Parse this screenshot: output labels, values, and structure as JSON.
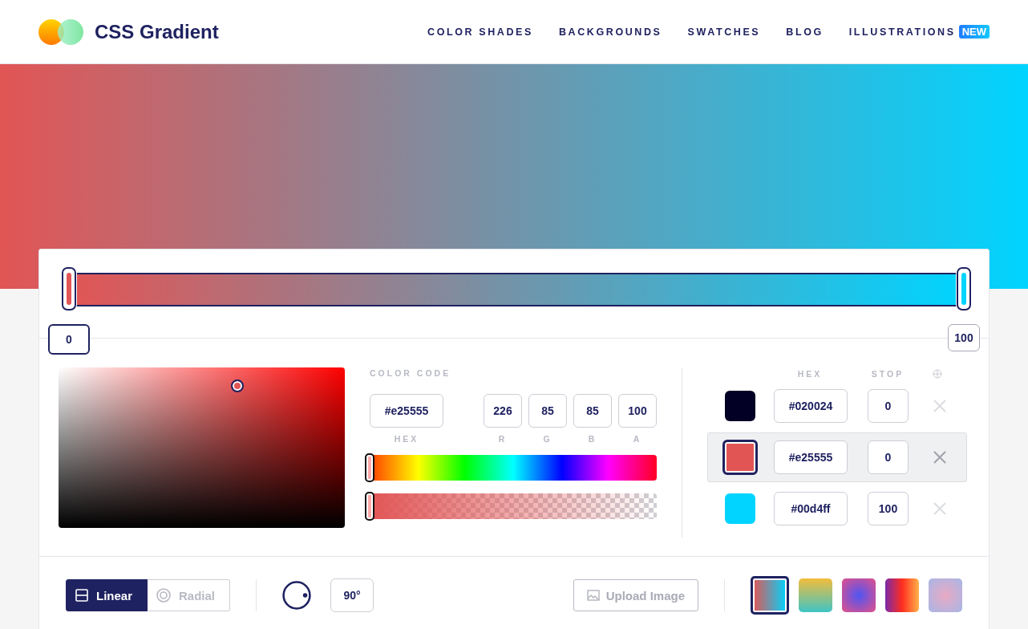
{
  "brand": {
    "name": "CSS Gradient"
  },
  "nav": [
    {
      "label": "COLOR SHADES"
    },
    {
      "label": "BACKGROUNDS"
    },
    {
      "label": "SWATCHES"
    },
    {
      "label": "BLOG"
    },
    {
      "label": "ILLUSTRATIONS",
      "badge": "NEW"
    }
  ],
  "gradient_bar": {
    "handles": [
      {
        "label": "0",
        "color": "#e25555",
        "level": 0,
        "selected": true
      },
      {
        "label": "100",
        "color": "#00d4ff",
        "level": 1,
        "selected": false
      }
    ]
  },
  "color_code": {
    "title": "COLOR CODE",
    "hex": {
      "value": "#e25555",
      "caption": "HEX"
    },
    "channels": [
      {
        "value": "226",
        "caption": "R"
      },
      {
        "value": "85",
        "caption": "G"
      },
      {
        "value": "85",
        "caption": "B"
      },
      {
        "value": "100",
        "caption": "A"
      }
    ],
    "hue_slider": {
      "level": 0
    },
    "alpha_slider": {
      "level": 0
    }
  },
  "stops": {
    "columns": [
      "HEX",
      "STOP"
    ],
    "rows": [
      {
        "color": "#020024",
        "hex": "#020024",
        "stop": "0",
        "selected": false
      },
      {
        "color": "#e25555",
        "hex": "#e25555",
        "stop": "0",
        "selected": true
      },
      {
        "color": "#00d4ff",
        "hex": "#00d4ff",
        "stop": "100",
        "selected": false
      }
    ]
  },
  "modes": [
    {
      "label": "Linear",
      "kind": "linear",
      "selected": true
    },
    {
      "label": "Radial",
      "kind": "radial",
      "selected": false
    }
  ],
  "angle": "90°",
  "upload": {
    "label": "Upload Image"
  },
  "presets": [
    {
      "kind": "coral",
      "selected": true
    },
    {
      "kind": "meadow",
      "selected": false
    },
    {
      "kind": "orchid",
      "selected": false
    },
    {
      "kind": "flame",
      "selected": false
    },
    {
      "kind": "haze",
      "selected": false
    }
  ]
}
